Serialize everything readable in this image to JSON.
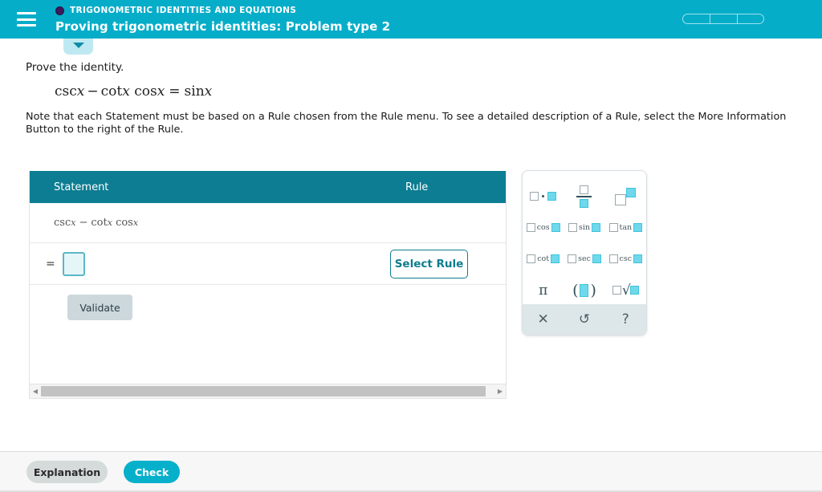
{
  "header": {
    "menu_icon": "hamburger-menu-icon",
    "category_dot_icon": "category-dot-icon",
    "category": "TRIGONOMETRIC IDENTITIES AND EQUATIONS",
    "title": "Proving trigonometric identities: Problem type 2",
    "progress_segments": 3,
    "colors": {
      "header_bg": "#05adc9",
      "table_header_bg": "#0c7d92",
      "accent": "#06b0cb"
    }
  },
  "collapse_tab": {
    "icon": "chevron-down-icon"
  },
  "content": {
    "prompt": "Prove the identity.",
    "identity": {
      "lhs_csc": "csc",
      "var1": "x",
      "minus": "−",
      "cot": "cot",
      "var2": "x",
      "cos": "cos",
      "var3": "x",
      "equals": "=",
      "sin": "sin",
      "var4": "x",
      "full_text": "csc x − cot x cos x = sin x"
    },
    "note": "Note that each Statement must be based on a Rule chosen from the Rule menu. To see a detailed description of a Rule, select the More Information Button to the right of the Rule."
  },
  "proof_table": {
    "columns": [
      "Statement",
      "Rule"
    ],
    "rows": [
      {
        "statement_csc": "csc",
        "statement_var1": "x",
        "statement_minus": "−",
        "statement_cot": "cot",
        "statement_var2": "x",
        "statement_cos": "cos",
        "statement_var3": "x",
        "statement_full": "csc x − cot x cos x",
        "rule": ""
      }
    ],
    "input_row": {
      "equals_sign": "=",
      "answer_value": "",
      "answer_placeholder": "",
      "rule_button_label": "Select Rule"
    },
    "validate_label": "Validate",
    "scrollbar": {
      "left_arrow_icon": "scroll-left-arrow-icon",
      "right_arrow_icon": "scroll-right-arrow-icon"
    }
  },
  "keypad": {
    "rows": [
      [
        {
          "name": "multiply-key",
          "type": "multiply",
          "label": ""
        },
        {
          "name": "fraction-key",
          "type": "fraction",
          "label": ""
        },
        {
          "name": "exponent-key",
          "type": "exponent",
          "label": ""
        }
      ],
      [
        {
          "name": "cos-key",
          "type": "trig",
          "label": "cos"
        },
        {
          "name": "sin-key",
          "type": "trig",
          "label": "sin"
        },
        {
          "name": "tan-key",
          "type": "trig",
          "label": "tan"
        }
      ],
      [
        {
          "name": "cot-key",
          "type": "trig",
          "label": "cot"
        },
        {
          "name": "sec-key",
          "type": "trig",
          "label": "sec"
        },
        {
          "name": "csc-key",
          "type": "trig",
          "label": "csc"
        }
      ],
      [
        {
          "name": "pi-key",
          "type": "pi",
          "label": "π"
        },
        {
          "name": "parentheses-key",
          "type": "paren",
          "label": ""
        },
        {
          "name": "radical-key",
          "type": "radical",
          "label": ""
        }
      ]
    ],
    "toolbar": [
      {
        "name": "clear-icon",
        "label": "✕"
      },
      {
        "name": "undo-icon",
        "label": "↺"
      },
      {
        "name": "help-icon",
        "label": "?"
      }
    ]
  },
  "footer": {
    "explanation_label": "Explanation",
    "check_label": "Check"
  }
}
